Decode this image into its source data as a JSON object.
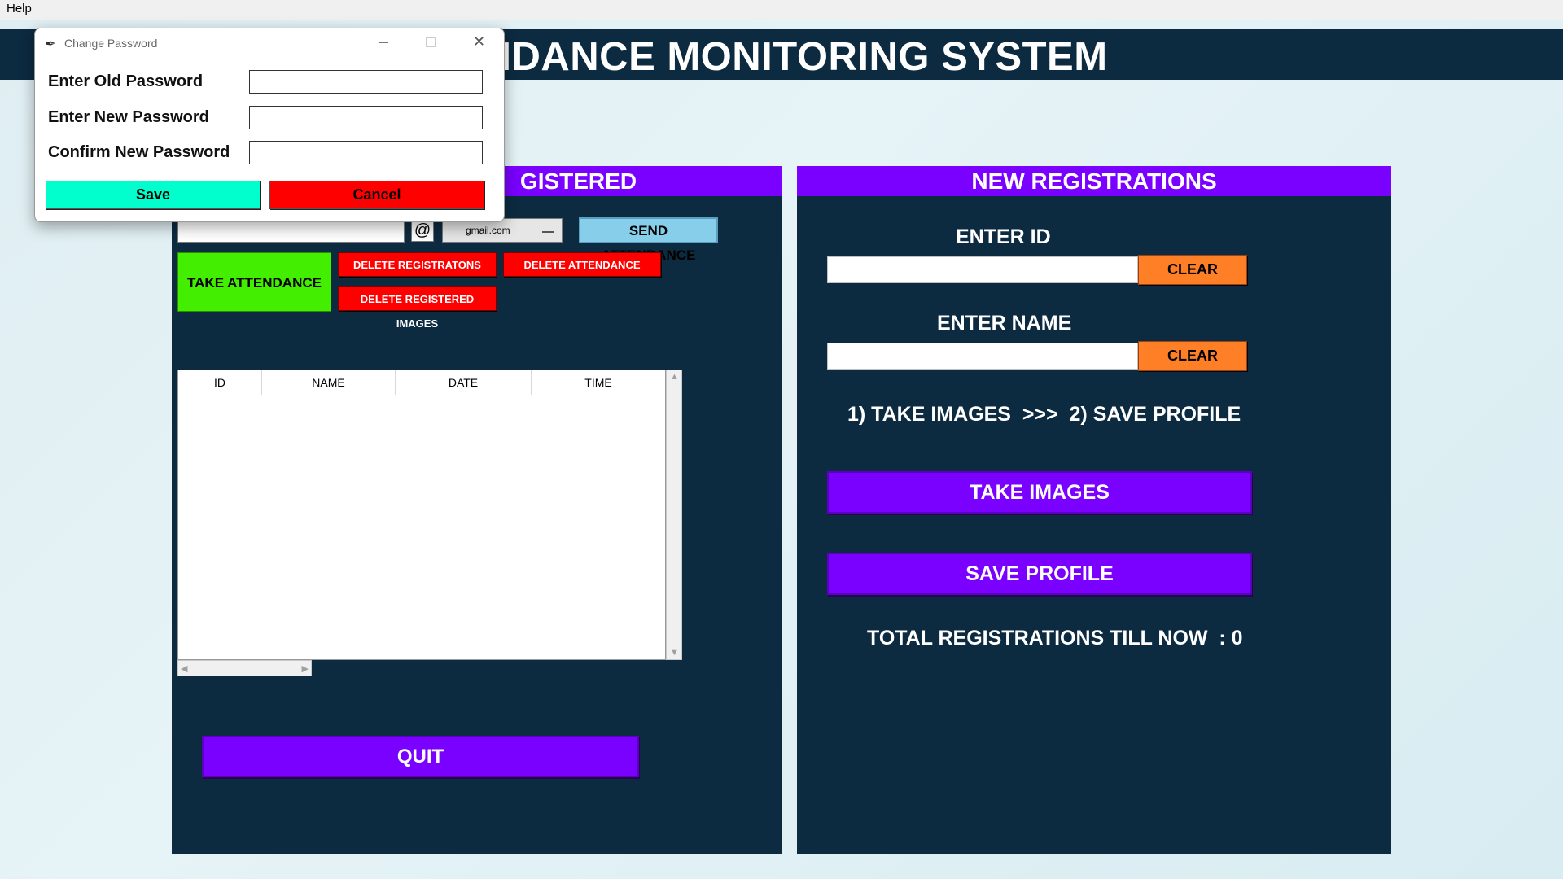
{
  "menu": {
    "help": "Help"
  },
  "app": {
    "title": "ENDANCE MONITORING SYSTEM"
  },
  "left": {
    "header": "GISTERED",
    "email_domain": "gmail.com",
    "at_symbol": "@",
    "send_attendance": "SEND ATTENDANCE",
    "take_attendance": "TAKE ATTENDANCE",
    "delete_registrations": "DELETE REGISTRATONS",
    "delete_attendance": "DELETE ATTENDANCE",
    "delete_images": "DELETE REGISTERED IMAGES",
    "table_columns": [
      "ID",
      "NAME",
      "DATE",
      "TIME"
    ],
    "quit": "QUIT"
  },
  "right": {
    "header": "NEW REGISTRATIONS",
    "enter_id": "ENTER ID",
    "enter_name": "ENTER NAME",
    "clear": "CLEAR",
    "steps": "1) TAKE IMAGES  >>>  2) SAVE PROFILE",
    "take_images": "TAKE IMAGES",
    "save_profile": "SAVE PROFILE",
    "total": "TOTAL REGISTRATIONS TILL NOW  : 0"
  },
  "dialog": {
    "title": "Change Password",
    "old_password": "Enter Old Password",
    "new_password": "Enter New Password",
    "confirm_password": "Confirm New Password",
    "save": "Save",
    "cancel": "Cancel",
    "save_color": "#00ffcc",
    "cancel_color": "#ff0000"
  },
  "colors": {
    "panel_bg": "#0c2a40",
    "header_purple": "#7a00ff",
    "take_attendance_green": "#44ee00",
    "send_blue": "#87ceeb",
    "clear_orange": "#ff7f27"
  }
}
